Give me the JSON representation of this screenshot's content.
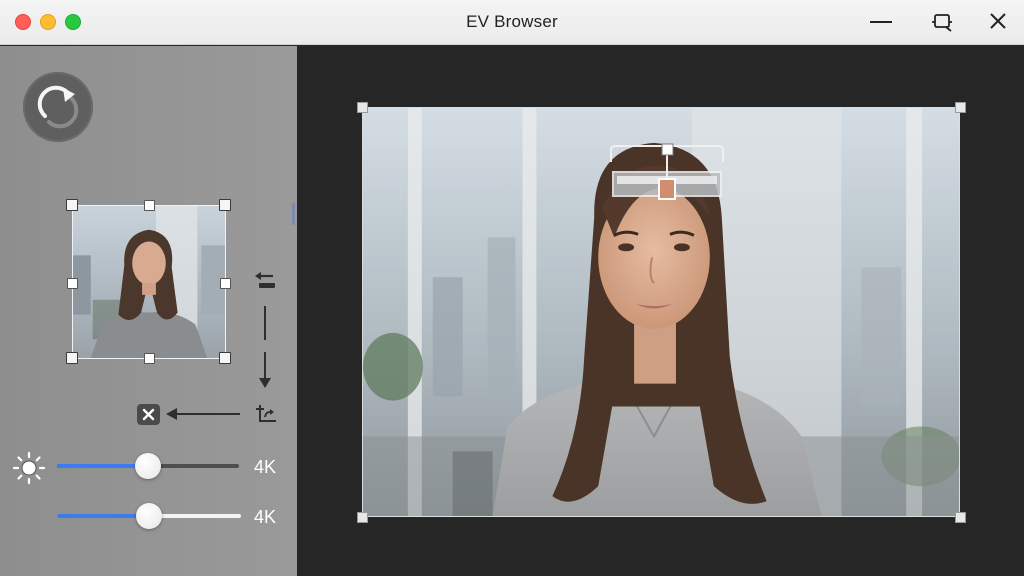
{
  "window": {
    "title": "EV Browser"
  },
  "sidebar": {
    "slider1": {
      "label": "4K",
      "value": 0.5
    },
    "slider2": {
      "label": "4K",
      "value": 0.5
    }
  },
  "colors": {
    "accent": "#3d7bf0",
    "sidebar": "#959595",
    "viewer_bg": "#262626",
    "close": "#ff5f57",
    "minimize": "#febc2e",
    "zoom": "#28c840"
  }
}
